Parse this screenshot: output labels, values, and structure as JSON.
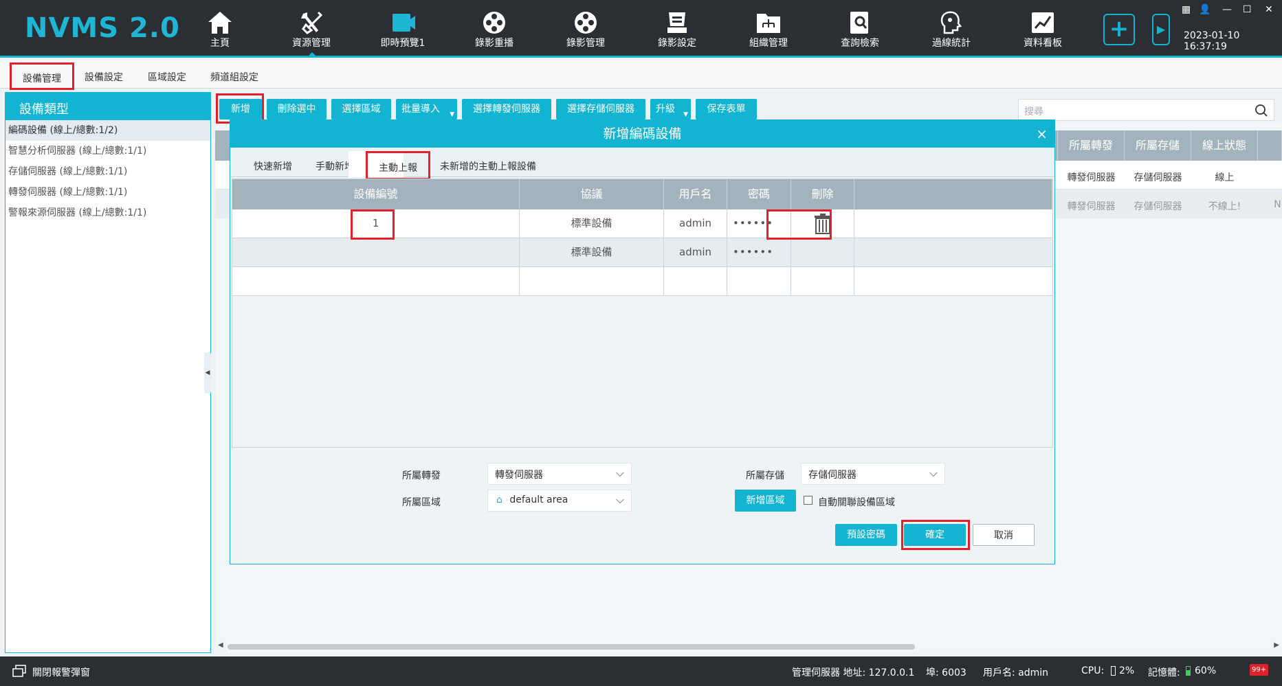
{
  "app": {
    "title": "NVMS 2.0",
    "datetime": "2023-01-10 16:37:19"
  },
  "nav": [
    {
      "label": "主頁",
      "icon": "home-icon"
    },
    {
      "label": "資源管理",
      "icon": "tools-icon"
    },
    {
      "label": "即時預覽1",
      "icon": "video-camera-icon"
    },
    {
      "label": "錄影重播",
      "icon": "film-reel-icon"
    },
    {
      "label": "錄影管理",
      "icon": "film-reel-icon"
    },
    {
      "label": "錄影設定",
      "icon": "recorder-icon"
    },
    {
      "label": "組織管理",
      "icon": "org-folder-icon"
    },
    {
      "label": "查詢檢索",
      "icon": "search-doc-icon"
    },
    {
      "label": "過線統計",
      "icon": "head-stats-icon"
    },
    {
      "label": "資料看板",
      "icon": "chart-board-icon"
    }
  ],
  "subtabs": [
    "設備管理",
    "設備設定",
    "區域設定",
    "頻道組設定"
  ],
  "left": {
    "header": "設備類型",
    "items": [
      "編碼設備 (線上/總數:1/2)",
      "智慧分析伺服器 (線上/總數:1/1)",
      "存儲伺服器 (線上/總數:1/1)",
      "轉發伺服器 (線上/總數:1/1)",
      "警報來源伺服器 (線上/總數:1/1)"
    ]
  },
  "toolbar": {
    "add": "新增",
    "delete_selected": "刪除選中",
    "select_area": "選擇區域",
    "batch_import": "批量導入",
    "select_forward": "選擇轉發伺服器",
    "select_storage": "選擇存儲伺服器",
    "upgrade": "升級",
    "save_form": "保存表單",
    "search_placeholder": "搜尋"
  },
  "bg_table": {
    "headers": [
      "所屬轉發",
      "所屬存儲",
      "線上狀態"
    ],
    "rows": [
      [
        "轉發伺服器",
        "存儲伺服器",
        "線上"
      ],
      [
        "轉發伺服器",
        "存儲伺服器",
        "不線上!",
        "N"
      ]
    ]
  },
  "dialog": {
    "title": "新增編碼設備",
    "close": "×",
    "tabs": [
      "快速新增",
      "手動新增",
      "主動上報",
      "未新增的主動上報設備"
    ],
    "columns": [
      "設備編號",
      "協議",
      "用戶名",
      "密碼",
      "刪除"
    ],
    "rows": [
      {
        "id": "1",
        "protocol": "標準設備",
        "user": "admin",
        "password": "••••••"
      },
      {
        "id": "",
        "protocol": "標準設備",
        "user": "admin",
        "password": "••••••"
      }
    ],
    "form": {
      "forward_label": "所屬轉發",
      "forward_value": "轉發伺服器",
      "storage_label": "所屬存儲",
      "storage_value": "存儲伺服器",
      "area_label": "所屬區域",
      "area_value": "default area",
      "add_area": "新增區域",
      "auto_link": "自動關聯設備區域"
    },
    "buttons": {
      "default_pwd": "預設密碼",
      "ok": "確定",
      "cancel": "取消"
    }
  },
  "status": {
    "alarm_popup": "關閉報警彈窗",
    "server_addr": "管理伺服器 地址: 127.0.0.1",
    "port": "埠: 6003",
    "user": "用戶名: admin",
    "cpu_label": "CPU:",
    "cpu": "2%",
    "mem_label": "記憶體:",
    "mem": "60%",
    "badge": "99+"
  },
  "colors": {
    "accent": "#13b4d1",
    "topbar": "#2b2e33",
    "highlight": "#e0202a"
  }
}
